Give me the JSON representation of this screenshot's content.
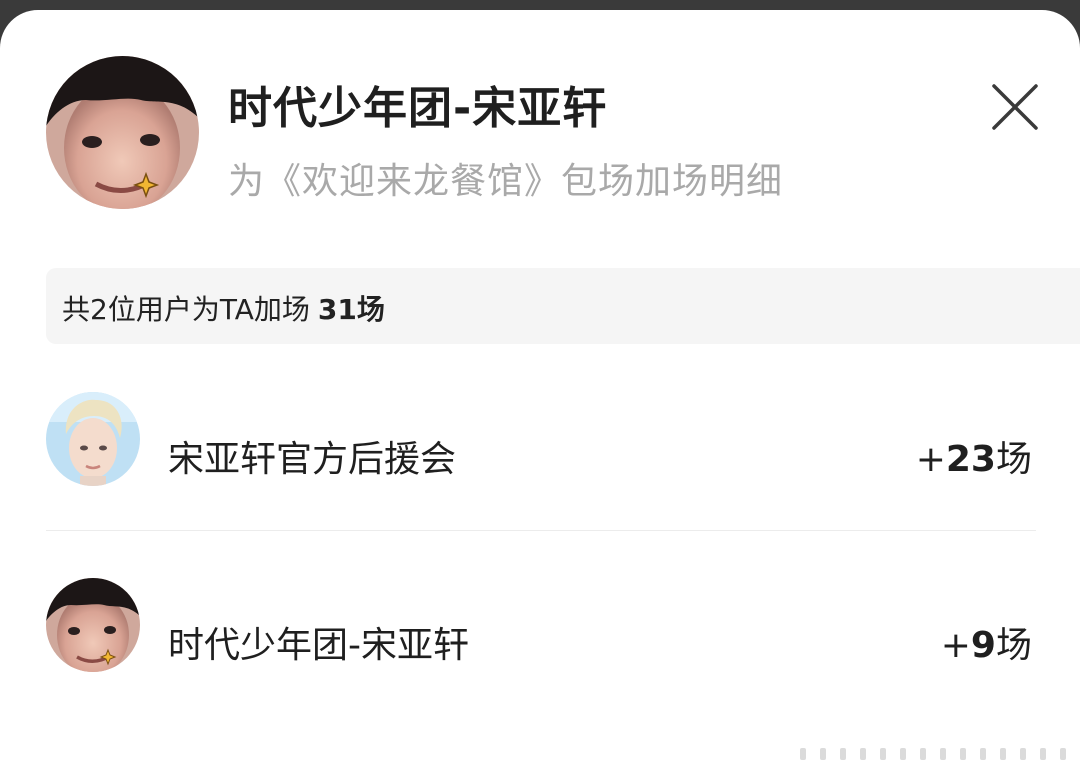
{
  "header": {
    "title": "时代少年团-宋亚轩",
    "subtitle": "为《欢迎来龙餐馆》包场加场明细",
    "close_icon": "close-icon"
  },
  "summary": {
    "text": "共2位用户为TA加场",
    "total": "31场"
  },
  "list": [
    {
      "name": "宋亚轩官方后援会",
      "prefix": "+",
      "count": "23",
      "unit": "场"
    },
    {
      "name": "时代少年团-宋亚轩",
      "prefix": "+",
      "count": "9",
      "unit": "场"
    }
  ],
  "colors": {
    "title": "#1f1f1f",
    "subtitle": "#a9a9a9",
    "summary_bg": "#f5f5f5",
    "divider": "#ececec"
  }
}
